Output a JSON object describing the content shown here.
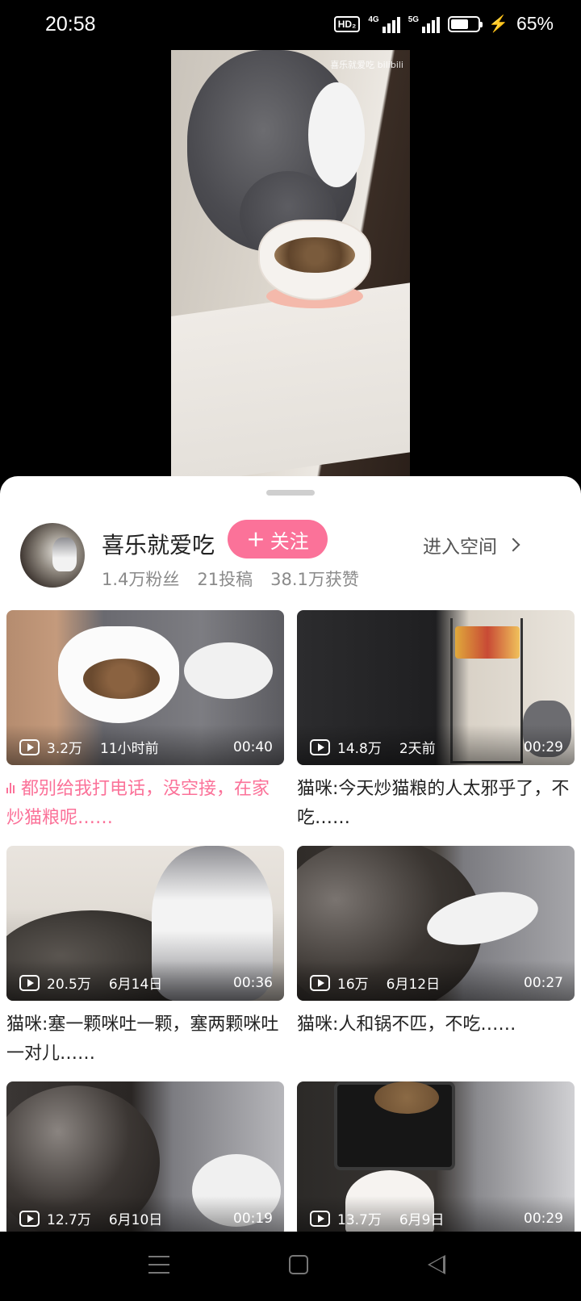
{
  "status_bar": {
    "time": "20:58",
    "hd_badge": "HD₂",
    "network_1": "4G",
    "network_2": "5G",
    "battery_level": 0.65,
    "battery_text": "65%"
  },
  "video": {
    "watermark": "喜乐就爱吃 bilibili"
  },
  "author": {
    "name": "喜乐就爱吃",
    "follow_label": "关注",
    "fans": "1.4万粉丝",
    "posts": "21投稿",
    "likes": "38.1万获赞",
    "space_link": "进入空间"
  },
  "videos": [
    {
      "views": "3.2万",
      "date": "11小时前",
      "duration": "00:40",
      "title": "都别给我打电话，没空接，在家炒猫粮呢……",
      "playing": true
    },
    {
      "views": "14.8万",
      "date": "2天前",
      "duration": "00:29",
      "title": "猫咪:今天炒猫粮的人太邪乎了，不吃……",
      "playing": false
    },
    {
      "views": "20.5万",
      "date": "6月14日",
      "duration": "00:36",
      "title": "猫咪:塞一颗咪吐一颗，塞两颗咪吐一对儿……",
      "playing": false
    },
    {
      "views": "16万",
      "date": "6月12日",
      "duration": "00:27",
      "title": "猫咪:人和锅不匹，不吃……",
      "playing": false
    },
    {
      "views": "12.7万",
      "date": "6月10日",
      "duration": "00:19",
      "title": "",
      "playing": false
    },
    {
      "views": "13.7万",
      "date": "6月9日",
      "duration": "00:29",
      "title": "",
      "playing": false
    }
  ],
  "colors": {
    "accent": "#fb7299",
    "background": "#000000",
    "sheet": "#ffffff"
  },
  "icons": {
    "follow": "plus-icon",
    "space": "chevron-right-icon",
    "play_count": "play-icon",
    "nav": [
      "menu-icon",
      "home-icon",
      "back-icon"
    ]
  }
}
